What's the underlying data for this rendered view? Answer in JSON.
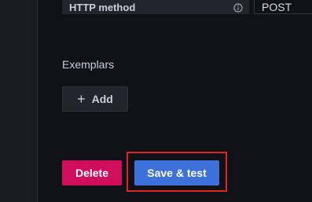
{
  "http_method": {
    "label": "HTTP method",
    "value": "POST",
    "info_icon": "info-icon"
  },
  "exemplars": {
    "label": "Exemplars",
    "add_label": "Add",
    "add_icon": "plus-icon"
  },
  "actions": {
    "delete_label": "Delete",
    "save_label": "Save & test"
  },
  "colors": {
    "delete": "#d10e5c",
    "save": "#3d71d9",
    "highlight": "#e02424",
    "background": "#111217"
  }
}
